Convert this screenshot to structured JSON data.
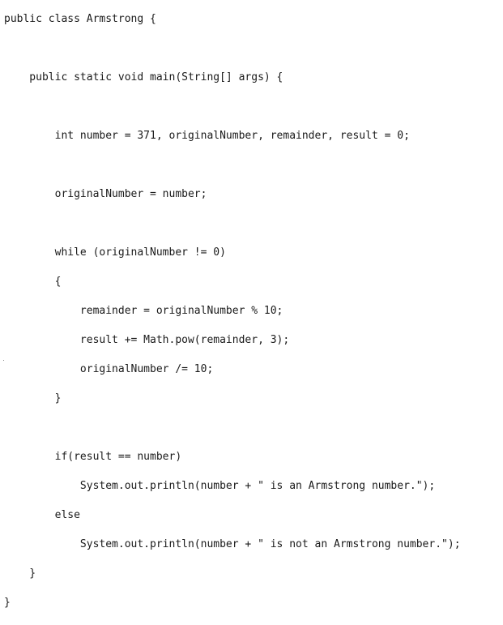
{
  "code": {
    "lines": [
      "public class Armstrong {",
      "",
      "    public static void main(String[] args) {",
      "",
      "        int number = 371, originalNumber, remainder, result = 0;",
      "",
      "        originalNumber = number;",
      "",
      "        while (originalNumber != 0)",
      "        {",
      "            remainder = originalNumber % 10;",
      "            result += Math.pow(remainder, 3);",
      "            originalNumber /= 10;",
      "        }",
      "",
      "        if(result == number)",
      "            System.out.println(number + \" is an Armstrong number.\");",
      "        else",
      "            System.out.println(number + \" is not an Armstrong number.\");",
      "    }",
      "}"
    ]
  }
}
